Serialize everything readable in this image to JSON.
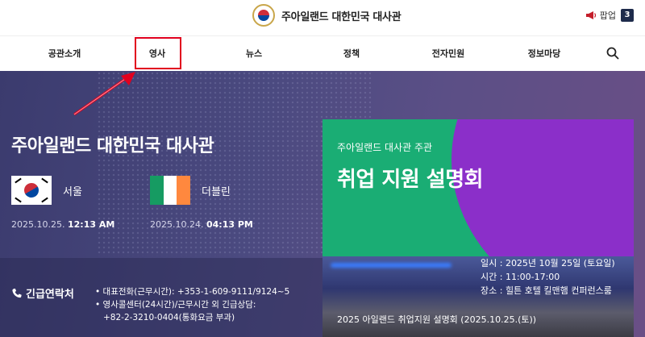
{
  "header": {
    "site_title": "주아일랜드 대한민국 대사관",
    "popup_label": "팝업",
    "popup_count": "3",
    "icons": {
      "emblem": "government-emblem-icon",
      "megaphone": "megaphone-icon",
      "search": "search-icon",
      "phone": "phone-icon"
    }
  },
  "nav": {
    "items": [
      "공관소개",
      "영사",
      "뉴스",
      "정책",
      "전자민원",
      "정보마당"
    ]
  },
  "hero": {
    "title": "주아일랜드 대한민국 대사관",
    "cities": [
      {
        "name": "서울",
        "date": "2025.10.25.",
        "time": "12:13 AM",
        "flag": "korea-flag"
      },
      {
        "name": "더블린",
        "date": "2025.10.24.",
        "time": "04:13 PM",
        "flag": "ireland-flag"
      }
    ],
    "contact": {
      "label": "긴급연락처",
      "lines": [
        "• 대표전화(근무시간): +353-1-609-9111/9124~5",
        "• 영사콜센터(24시간)/근무시간 외 긴급상담:",
        "+82-2-3210-0404(통화요금 부과)"
      ]
    }
  },
  "banner": {
    "host": "주아일랜드 대사관 주관",
    "title": "취업 지원 설명회",
    "info": [
      "일시 : 2025년 10월 25일 (토요일)",
      "시간 : 11:00-17:00",
      "장소 : 힐튼 호텔 킬맨햄 컨퍼런스룸"
    ],
    "caption": "2025 아일랜드 취업지원 설명회 (2025.10.25.(토))"
  },
  "colors": {
    "accent_red": "#e1001e",
    "banner_green": "#1aad74",
    "banner_purple": "#8b2fc9",
    "hero_bg": "#4b4a80",
    "popup_badge": "#1e2b4b"
  }
}
